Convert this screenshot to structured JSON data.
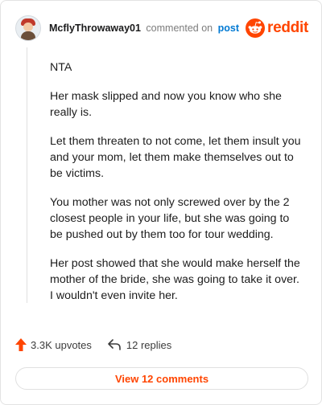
{
  "header": {
    "username": "McflyThrowaway01",
    "commented_on": "commented on",
    "post_link": "post",
    "brand_wordmark": "reddit",
    "brand_color": "#ff4500",
    "link_color": "#0079d3"
  },
  "comment": {
    "paragraphs": [
      "NTA",
      "Her mask slipped and now you know who she really is.",
      "Let them threaten to not come, let them insult you and your mom, let them make themselves out to be victims.",
      "You mother was not only screwed over by the 2 closest people in your life, but she was going to be pushed out by them too for tour wedding.",
      "Her post showed that she would make herself the mother of the bride, she was going to take it over. I wouldn't even invite her."
    ]
  },
  "actions": {
    "upvotes": "3.3K upvotes",
    "replies": "12 replies",
    "upvote_icon": "upvote-arrow-icon",
    "reply_icon": "reply-arrow-icon"
  },
  "footer": {
    "view_comments_label": "View 12 comments"
  }
}
